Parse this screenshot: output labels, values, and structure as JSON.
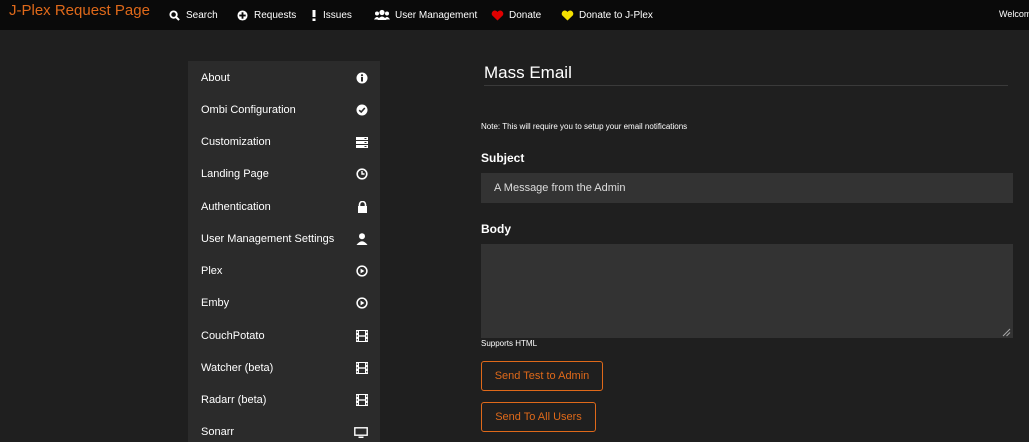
{
  "navbar": {
    "brand": "J-Plex Request Page",
    "items": [
      {
        "label": "Search",
        "icon": "search-icon"
      },
      {
        "label": "Requests",
        "icon": "plus-circle-icon"
      },
      {
        "label": "Issues",
        "icon": "exclamation-icon"
      },
      {
        "label": "User Management",
        "icon": "users-icon"
      },
      {
        "label": "Donate",
        "icon": "heart-icon",
        "color": "#e00000"
      },
      {
        "label": "Donate to J-Plex",
        "icon": "heart-icon",
        "color": "#f5e000"
      }
    ],
    "welcome": "Welcom"
  },
  "sidebar": {
    "items": [
      {
        "label": "About",
        "icon": "info-icon"
      },
      {
        "label": "Ombi Configuration",
        "icon": "check-circle-icon"
      },
      {
        "label": "Customization",
        "icon": "server-icon"
      },
      {
        "label": "Landing Page",
        "icon": "clock-icon"
      },
      {
        "label": "Authentication",
        "icon": "lock-icon"
      },
      {
        "label": "User Management Settings",
        "icon": "user-icon"
      },
      {
        "label": "Plex",
        "icon": "play-circle-icon"
      },
      {
        "label": "Emby",
        "icon": "play-circle-icon"
      },
      {
        "label": "CouchPotato",
        "icon": "film-icon"
      },
      {
        "label": "Watcher (beta)",
        "icon": "film-icon"
      },
      {
        "label": "Radarr (beta)",
        "icon": "film-icon"
      },
      {
        "label": "Sonarr",
        "icon": "monitor-icon"
      }
    ]
  },
  "main": {
    "title": "Mass Email",
    "note": "Note: This will require you to setup your email notifications",
    "subject_label": "Subject",
    "subject_value": "A Message from the Admin",
    "body_label": "Body",
    "body_hint": "Supports HTML",
    "send_test_label": "Send Test to Admin",
    "send_all_label": "Send To All Users"
  },
  "colors": {
    "accent": "#df691a",
    "navbar_bg": "#0a0a0a",
    "page_bg": "#1f1f1f",
    "sidebar_bg": "#2b2b2b",
    "input_bg": "#333333"
  }
}
